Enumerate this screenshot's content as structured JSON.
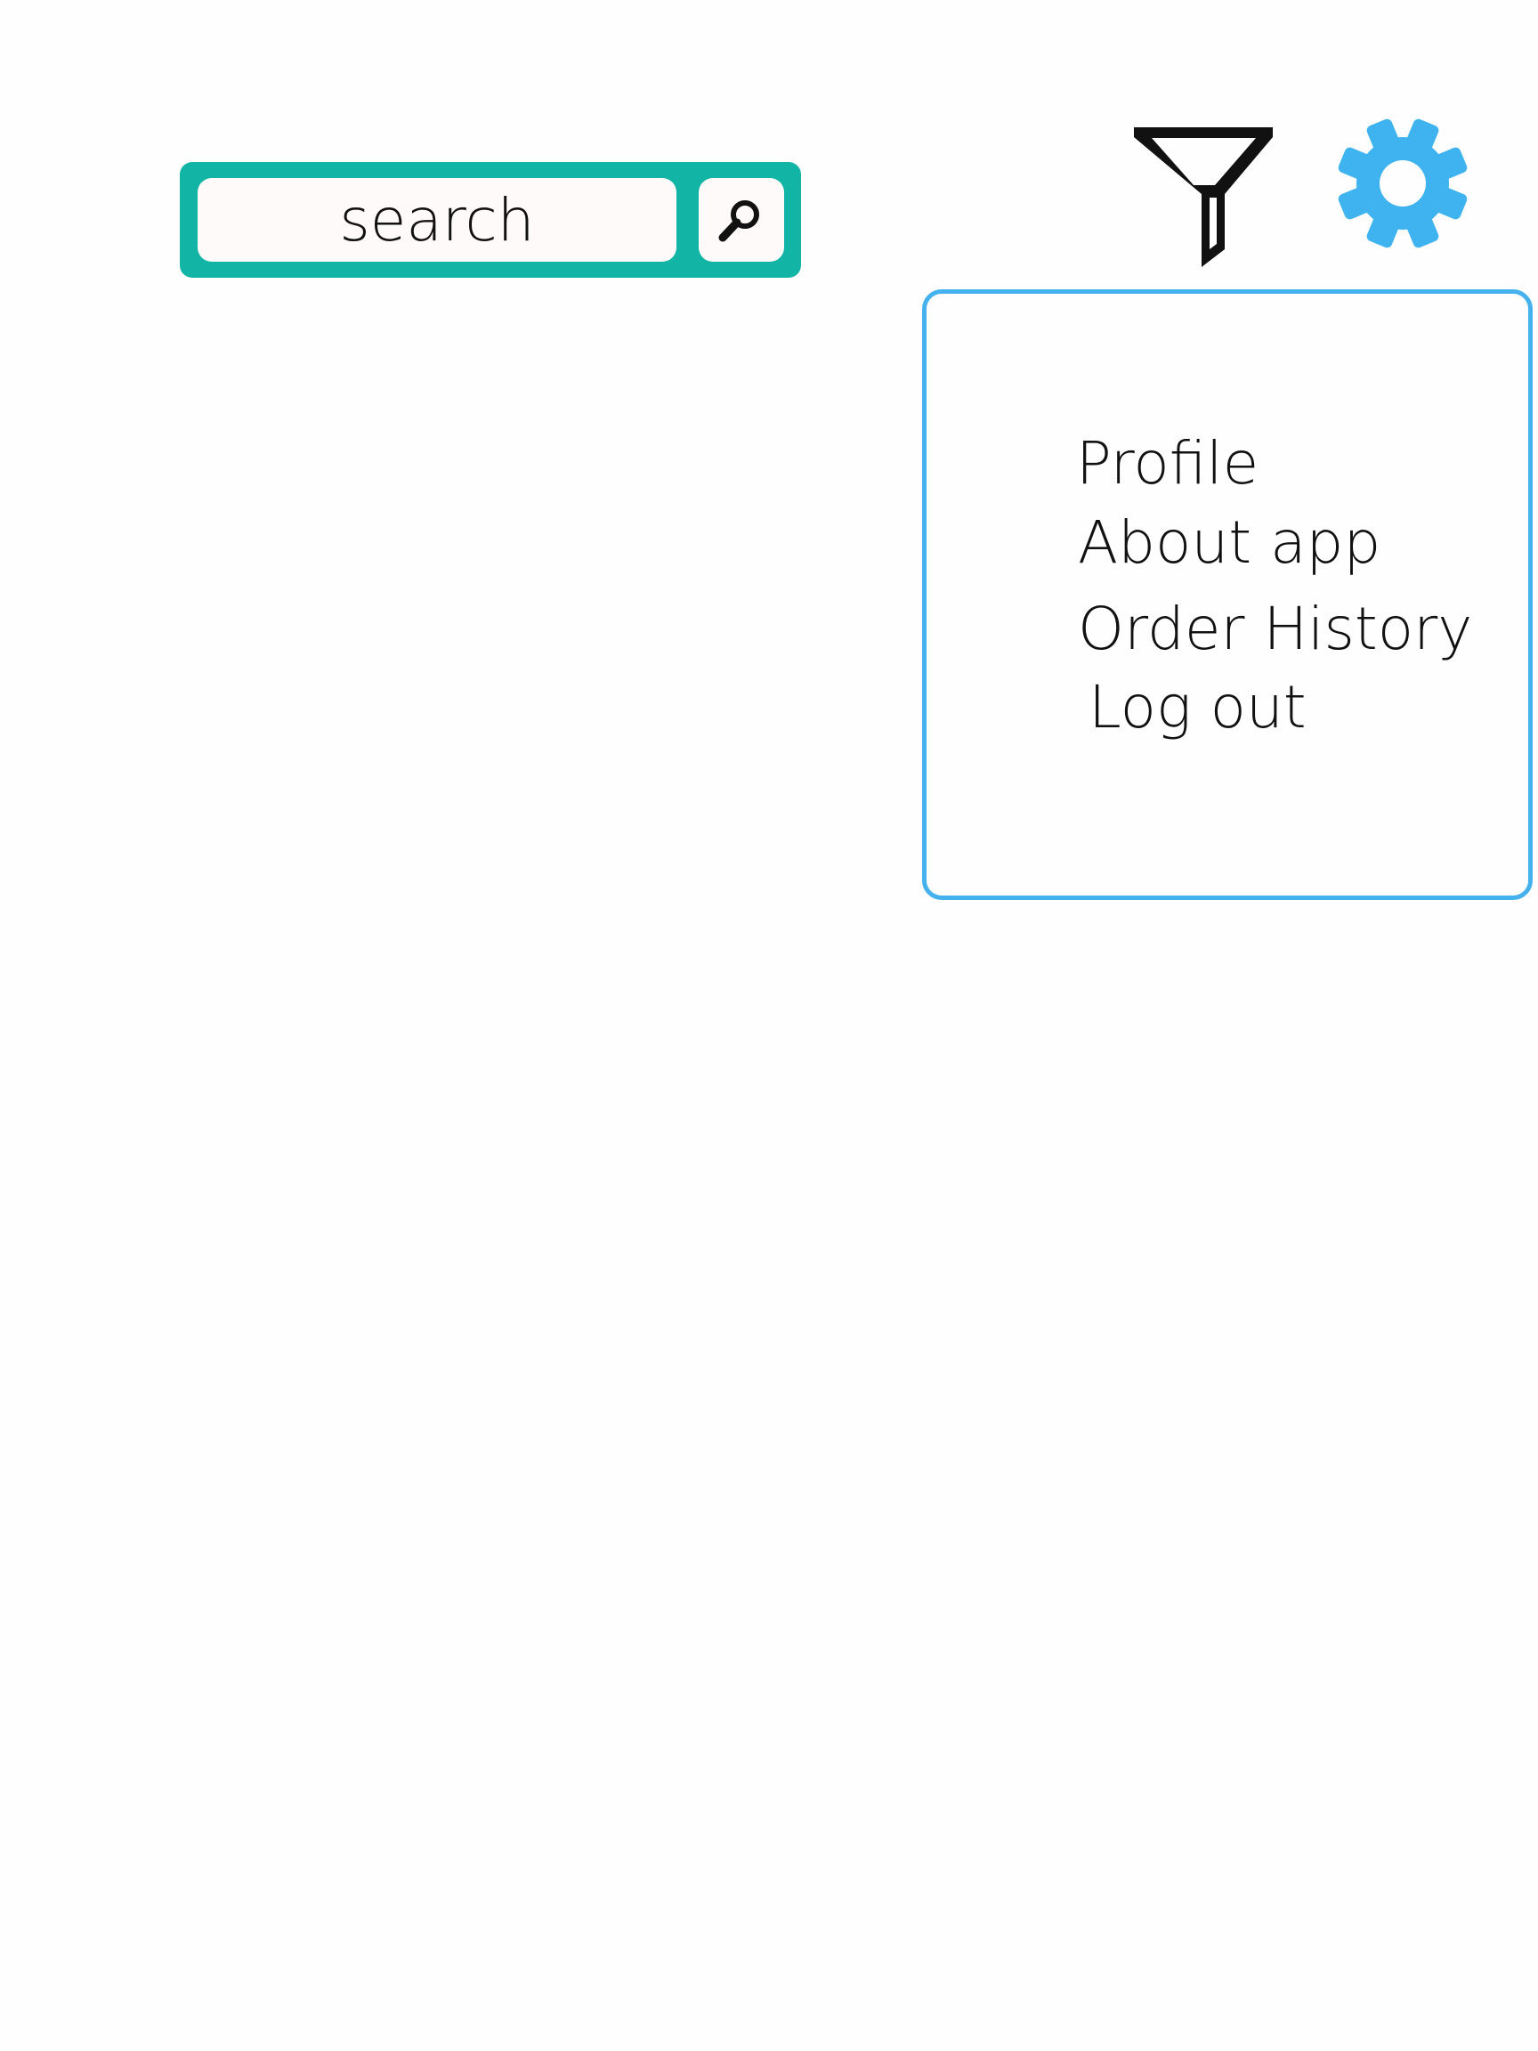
{
  "colors": {
    "search_bar_frame": "#12b5a5",
    "menu_border": "#45b2ee",
    "gear_icon": "#3fb3ef",
    "filter_icon": "#111111",
    "background": "#fefefe"
  },
  "header": {
    "search": {
      "placeholder": "search",
      "value": "",
      "button_icon": "magnifier-icon"
    },
    "filter_icon": "filter-funnel-icon",
    "settings_icon": "gear-icon"
  },
  "settings_menu": {
    "items": [
      {
        "label": "Profile"
      },
      {
        "label": "About app"
      },
      {
        "label": "Order History"
      },
      {
        "label": "Log out"
      }
    ]
  }
}
